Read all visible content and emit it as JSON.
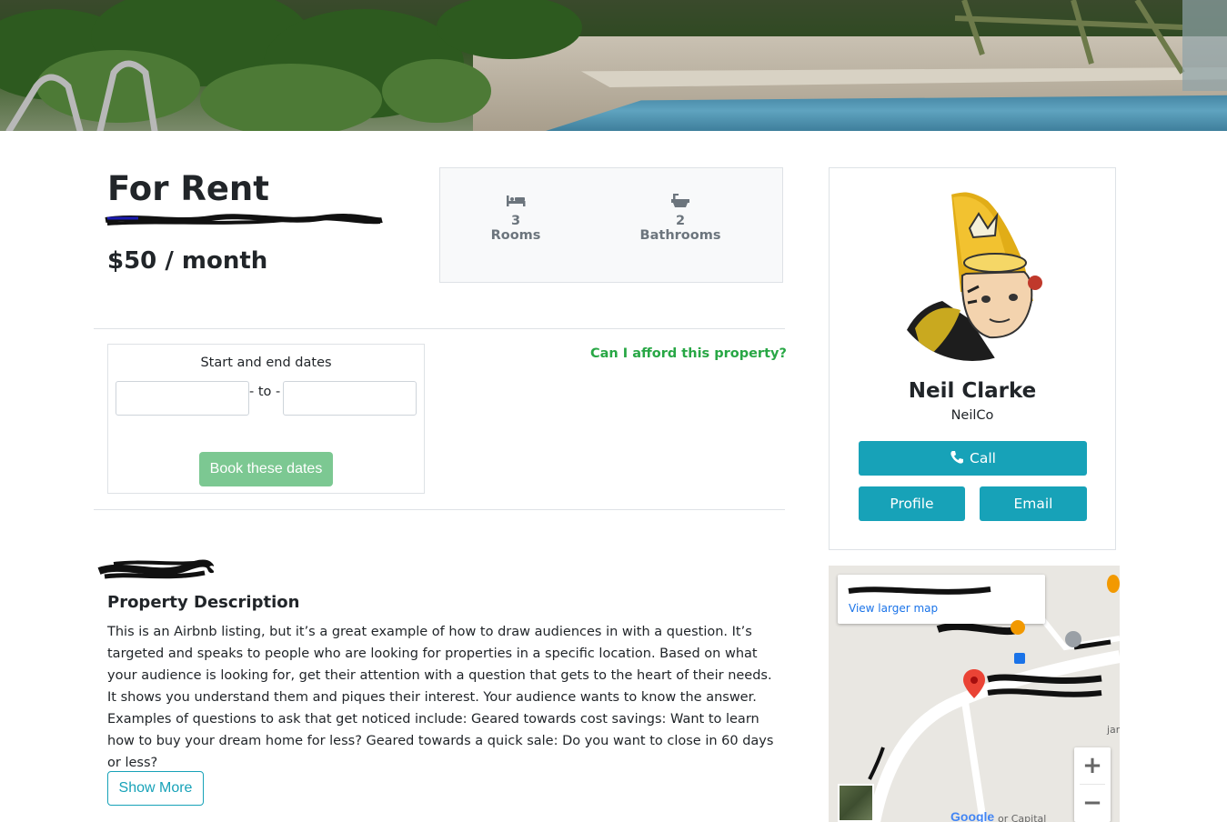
{
  "listing": {
    "status_title": "For Rent",
    "price": "$50 / month",
    "features": [
      {
        "icon": "bed-icon",
        "label": "3 Rooms"
      },
      {
        "icon": "bath-icon",
        "label": "2 Bathrooms"
      }
    ]
  },
  "booking": {
    "label": "Start and end dates",
    "start_value": "",
    "separator": "- to -",
    "end_value": "",
    "book_button": "Book these dates"
  },
  "afford_link": "Can I afford this property?",
  "description": {
    "title": "Property Description",
    "text": "This is an Airbnb listing, but it’s a great example of how to draw audiences in with a question. It’s targeted and speaks to people who are looking for properties in a specific location. Based on what your audience is looking for, get their attention with a question that gets to the heart of their needs. It shows you understand them and piques their interest. Your audience wants to know the answer. Examples of questions to ask that get noticed include: Geared towards cost savings: Want to learn how to buy your dream home for less? Geared towards a quick sale: Do you want to close in 60 days or less?",
    "show_more": "Show More"
  },
  "agent": {
    "name": "Neil Clarke",
    "company": "NeilCo",
    "call_button": "Call",
    "profile_button": "Profile",
    "email_button": "Email"
  },
  "map": {
    "view_larger": "View larger map",
    "zoom_in": "+",
    "zoom_out": "−",
    "google": "Google",
    "partial_label_1": "jar",
    "partial_label_2": "or Capital"
  },
  "colors": {
    "teal": "#17a2b8",
    "green": "#28a745",
    "book_button": "#7cc892"
  }
}
